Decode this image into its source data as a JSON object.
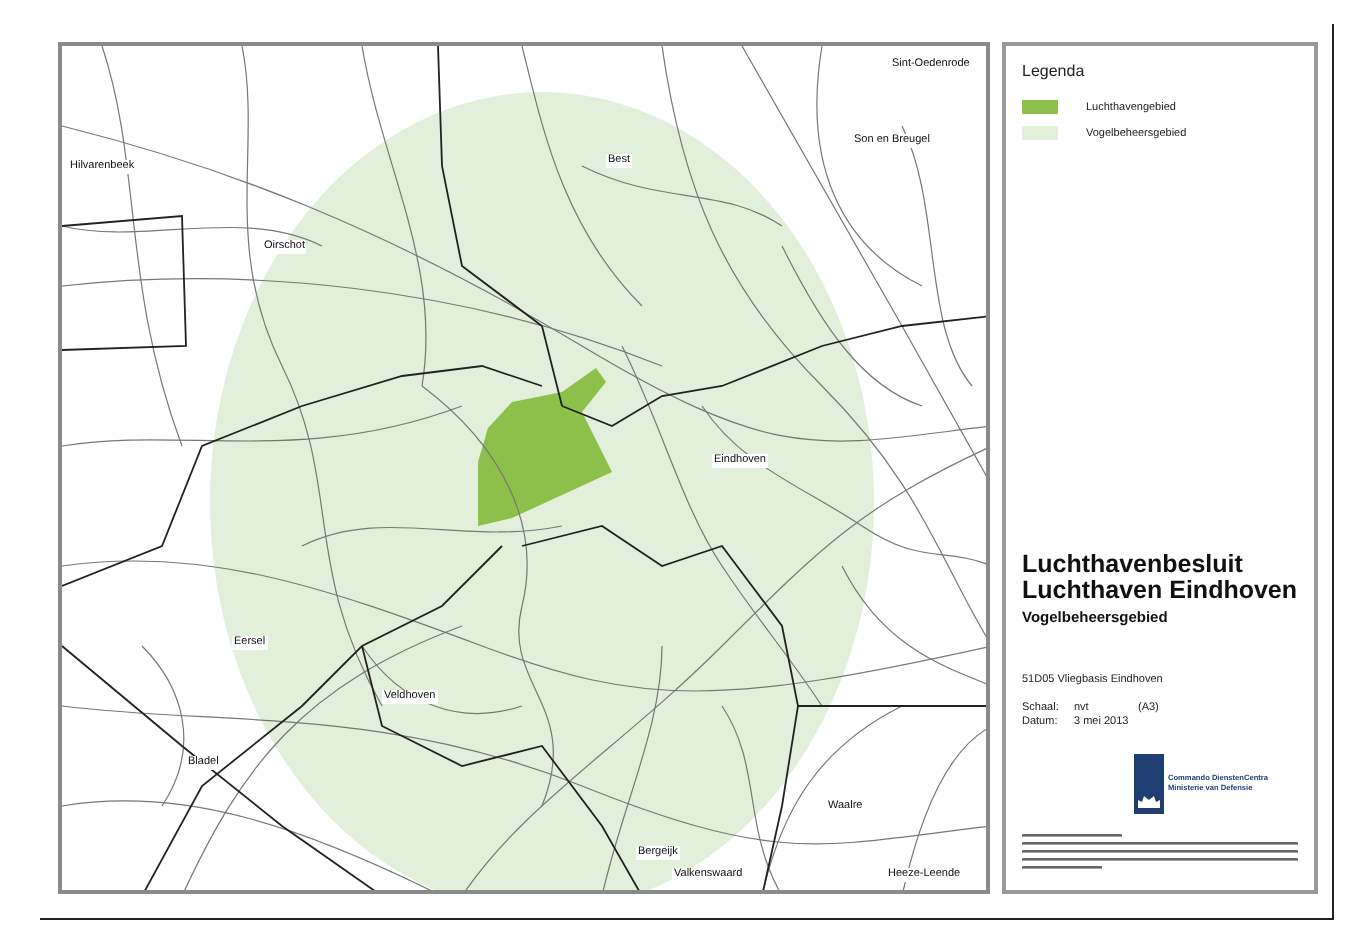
{
  "map": {
    "places": [
      {
        "name": "Sint-Oedenrode"
      },
      {
        "name": "Hilvarenbeek"
      },
      {
        "name": "Best"
      },
      {
        "name": "Son en Breugel"
      },
      {
        "name": "Oirschot"
      },
      {
        "name": "Eindhoven"
      },
      {
        "name": "Eersel"
      },
      {
        "name": "Veldhoven"
      },
      {
        "name": "Bladel"
      },
      {
        "name": "Waalre"
      },
      {
        "name": "Bergeijk"
      },
      {
        "name": "Valkenswaard"
      },
      {
        "name": "Heeze-Leende"
      }
    ]
  },
  "legend": {
    "title": "Legenda",
    "items": [
      {
        "label": "Luchthavengebied",
        "color": "#8dc04a"
      },
      {
        "label": "Vogelbeheersgebied",
        "color": "#e2efda"
      }
    ]
  },
  "title_block": {
    "title_lines": [
      "Luchthavenbesluit",
      "Luchthaven Eindhoven"
    ],
    "subtitle": "Vogelbeheersgebied",
    "code": "51D05  Vliegbasis Eindhoven",
    "scale_label": "Schaal:",
    "scale_value": "nvt",
    "paper": "(A3)",
    "date_label": "Datum:",
    "date_value": "3 mei 2013",
    "logo_lines": [
      "Commando DienstenCentra",
      "Ministerie van Defensie"
    ]
  }
}
